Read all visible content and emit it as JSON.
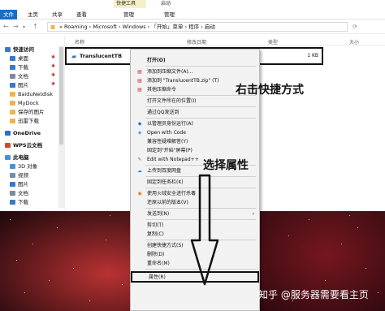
{
  "window": {
    "title": "启动",
    "context_tab_1": "快捷工具",
    "context_tab_2": "应用程序工具",
    "ribbon_tabs": [
      "文件",
      "主页",
      "共享",
      "查看",
      "管理",
      "管理"
    ]
  },
  "address": {
    "path": "« Roaming › Microsoft › Windows › 「开始」菜单 › 程序 › 启动"
  },
  "columns": {
    "name": "名称",
    "modified": "修改日期",
    "type": "类型",
    "size": "大小"
  },
  "sidebar": {
    "items": [
      {
        "label": "快速访问",
        "icon_color": "#3a78c8",
        "pinned": false
      },
      {
        "label": "桌面",
        "icon_color": "#3a78c8",
        "pinned": true
      },
      {
        "label": "下载",
        "icon_color": "#3a78c8",
        "pinned": true
      },
      {
        "label": "文档",
        "icon_color": "#7a8aa0",
        "pinned": true
      },
      {
        "label": "图片",
        "icon_color": "#3a78c8",
        "pinned": true
      },
      {
        "label": "BaiduNetdisk",
        "icon_color": "#e8b84a",
        "pinned": false
      },
      {
        "label": "MyDock",
        "icon_color": "#e8b84a",
        "pinned": false
      },
      {
        "label": "保存的图片",
        "icon_color": "#e8b84a",
        "pinned": false
      },
      {
        "label": "迅雷下载",
        "icon_color": "#e8b84a",
        "pinned": false
      },
      {
        "label": "OneDrive",
        "icon_color": "#2a6fd6",
        "pinned": false
      },
      {
        "label": "WPS云文档",
        "icon_color": "#d04a2a",
        "pinned": false
      },
      {
        "label": "此电脑",
        "icon_color": "#4a90d9",
        "pinned": false
      },
      {
        "label": "3D 对象",
        "icon_color": "#4a90d9",
        "pinned": false
      },
      {
        "label": "视频",
        "icon_color": "#7a8aa0",
        "pinned": false
      },
      {
        "label": "图片",
        "icon_color": "#3a78c8",
        "pinned": false
      },
      {
        "label": "文档",
        "icon_color": "#7a8aa0",
        "pinned": false
      },
      {
        "label": "下载",
        "icon_color": "#3a78c8",
        "pinned": false
      }
    ]
  },
  "file": {
    "name": "TranslucentTB",
    "size": "1 KB"
  },
  "context_menu": {
    "items": [
      {
        "label": "打开(O)",
        "icon": "",
        "submenu": false
      },
      {
        "sep": true
      },
      {
        "label": "添加到压缩文件(A)...",
        "icon": "archive-icon",
        "submenu": false
      },
      {
        "label": "添加到 \"TranslucentTB.zip\" (T)",
        "icon": "archive-icon",
        "submenu": false
      },
      {
        "label": "其他压缩命令",
        "icon": "archive-icon",
        "submenu": true
      },
      {
        "sep": true
      },
      {
        "label": "打开文件所在的位置(I)",
        "icon": "",
        "submenu": false
      },
      {
        "sep": true
      },
      {
        "label": "通过QQ发送到",
        "icon": "",
        "submenu": false
      },
      {
        "sep": true
      },
      {
        "label": "以管理员身份运行(A)",
        "icon": "shield-icon",
        "submenu": false
      },
      {
        "label": "Open with Code",
        "icon": "vscode-icon",
        "submenu": false
      },
      {
        "label": "兼容性疑难解答(Y)",
        "icon": "",
        "submenu": false
      },
      {
        "label": "固定到\"开始\"屏幕(P)",
        "icon": "",
        "submenu": false
      },
      {
        "label": "Edit with Notepad++",
        "icon": "notepad-icon",
        "submenu": false
      },
      {
        "sep": true
      },
      {
        "label": "上传到百度网盘",
        "icon": "cloud-icon",
        "submenu": false
      },
      {
        "sep": true
      },
      {
        "label": "固定到任务栏(K)",
        "icon": "",
        "submenu": false
      },
      {
        "sep": true
      },
      {
        "label": "使用火绒安全进行杀毒",
        "icon": "antivirus-icon",
        "submenu": false
      },
      {
        "label": "还原以前的版本(V)",
        "icon": "",
        "submenu": false
      },
      {
        "sep": true
      },
      {
        "label": "发送到(N)",
        "icon": "",
        "submenu": true
      },
      {
        "sep": true
      },
      {
        "label": "剪切(T)",
        "icon": "",
        "submenu": false
      },
      {
        "label": "复制(C)",
        "icon": "",
        "submenu": false
      },
      {
        "sep": true
      },
      {
        "label": "创建快捷方式(S)",
        "icon": "",
        "submenu": false
      },
      {
        "label": "删除(D)",
        "icon": "",
        "submenu": false
      },
      {
        "label": "重命名(M)",
        "icon": "",
        "submenu": false
      },
      {
        "sep": true
      },
      {
        "label": "属性(R)",
        "icon": "",
        "submenu": false
      }
    ]
  },
  "annotations": {
    "right_click": "右击快捷方式",
    "select_properties": "选择属性"
  },
  "watermark": "知乎 @服务器需要看主页",
  "colors": {
    "accent": "#1a6cc7",
    "highlight_box": "#111111",
    "contextual_tab": "#f6f0c8"
  }
}
